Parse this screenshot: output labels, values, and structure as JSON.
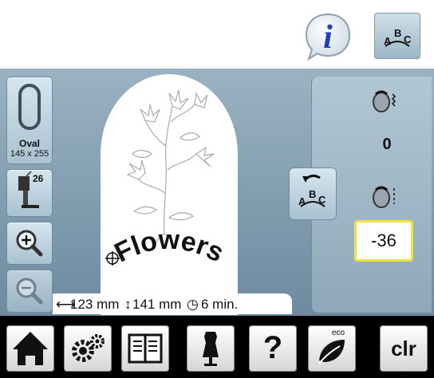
{
  "toolbar_top": {
    "info_button": "i",
    "abc_button": "ABC"
  },
  "left_panel": {
    "hoop": {
      "name": "Oval",
      "size": "145 x 255"
    },
    "presser_foot": "26"
  },
  "design": {
    "text": "Flowers"
  },
  "right_panel": {
    "top_value": "0",
    "arc_value": "-36"
  },
  "status_bar": {
    "width": "123 mm",
    "height": "141 mm",
    "time": "6 min."
  },
  "bottom_bar": {
    "help_label": "?",
    "eco_label": "eco",
    "clr_label": "clr"
  },
  "colors": {
    "screen_bg": "#8aa5b7",
    "highlight": "#f2e33c",
    "info_blue": "#1c3fc2"
  }
}
